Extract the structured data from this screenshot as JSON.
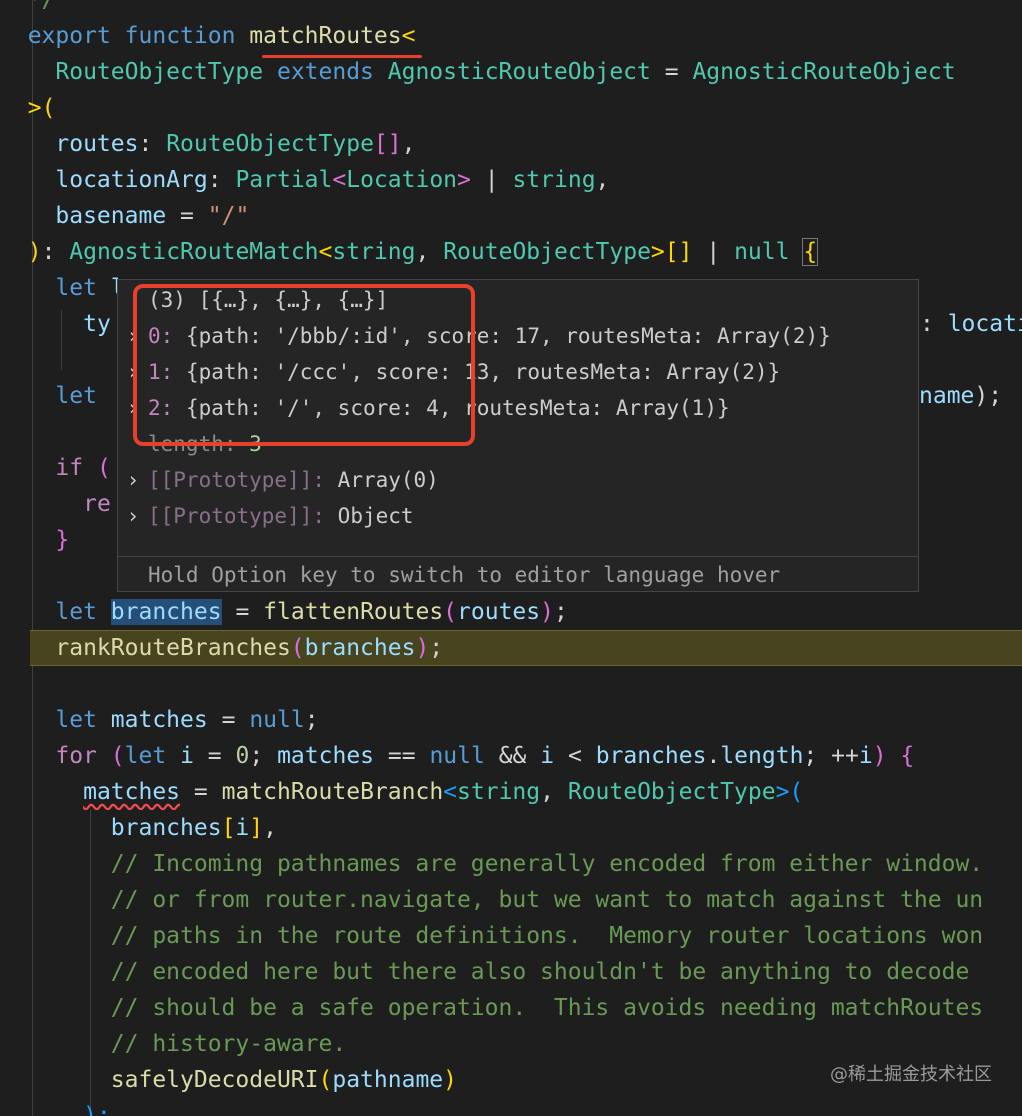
{
  "code": {
    "line0_comment": "*/",
    "line1": {
      "export": "export",
      "function": "function",
      "name": "matchRoutes",
      "open": "<"
    },
    "line2": {
      "tparam": "RouteObjectType",
      "extends": "extends",
      "t1": "AgnosticRouteObject",
      "eq": "=",
      "t2": "AgnosticRouteObject"
    },
    "line3": {
      "close": ">",
      "paren": "("
    },
    "line4": {
      "param": "routes",
      "colon": ":",
      "type": "RouteObjectType",
      "arr": "[]",
      "comma": ","
    },
    "line5": {
      "param": "locationArg",
      "colon": ":",
      "type": "Partial",
      "lt": "<",
      "inner": "Location",
      "gt": ">",
      "pipe": "|",
      "str": "string",
      "comma": ","
    },
    "line6": {
      "param": "basename",
      "eq": "=",
      "value": "\"/\""
    },
    "line7": {
      "paren": ")",
      "colon": ":",
      "type": "AgnosticRouteMatch",
      "lt": "<",
      "s": "string",
      "comma": ",",
      "t": "RouteObjectType",
      "gt": ">",
      "arr": "[]",
      "pipe": "|",
      "nul": "null",
      "brace": "{"
    },
    "line8": {
      "let": "let",
      "rest": "l"
    },
    "line9": {
      "partial": "ty",
      "right": "locati"
    },
    "line10": {
      "let": "let",
      "right": "name",
      "tail": ");"
    },
    "line11": {
      "if": "if",
      "paren": "("
    },
    "line12": {
      "partial": "re"
    },
    "line13": {
      "brace": "}"
    },
    "line14": {
      "let": "let",
      "var": "branches",
      "eq": "=",
      "fn": "flattenRoutes",
      "po": "(",
      "arg": "routes",
      "pc": ")",
      "semi": ";"
    },
    "line15": {
      "fn": "rankRouteBranches",
      "po": "(",
      "arg": "branches",
      "pc": ")",
      "semi": ";"
    },
    "line17": {
      "let": "let",
      "var": "matches",
      "eq": "=",
      "nul": "null",
      "semi": ";"
    },
    "line18": {
      "for": "for",
      "po": "(",
      "let": "let",
      "i": "i",
      "eq": "=",
      "zero": "0",
      "semi1": ";",
      "m": "matches",
      "eqeq": "==",
      "nul": "null",
      "and": "&&",
      "i2": "i",
      "lt": "<",
      "b": "branches",
      "dot": ".",
      "len": "length",
      "semi2": ";",
      "inc": "++",
      "i3": "i",
      "pc": ")",
      "brace": "{"
    },
    "line19": {
      "var": "matches",
      "eq": "=",
      "fn": "matchRouteBranch",
      "lt": "<",
      "s": "string",
      "comma": ",",
      "t": "RouteObjectType",
      "gt": ">",
      "po": "("
    },
    "line20": {
      "var": "branches",
      "bo": "[",
      "i": "i",
      "bc": "]",
      "comma": ","
    },
    "line21": "// Incoming pathnames are generally encoded from either window.",
    "line22": "// or from router.navigate, but we want to match against the un",
    "line23": "// paths in the route definitions.  Memory router locations won",
    "line24": "// encoded here but there also shouldn't be anything to decode",
    "line25": "// should be a safe operation.  This avoids needing matchRoutes",
    "line26": "// history-aware.",
    "line27": {
      "fn": "safelyDecodeURI",
      "po": "(",
      "arg": "pathname",
      "pc": ")"
    },
    "line28": {
      "close": ");"
    }
  },
  "hover": {
    "header": "(3) [{…}, {…}, {…}]",
    "items": [
      {
        "key": "0",
        "text": "{path: '/bbb/:id', score: 17, routesMeta: Array(2)}"
      },
      {
        "key": "1",
        "text": "{path: '/ccc', score: 13, routesMeta: Array(2)}"
      },
      {
        "key": "2",
        "text": "{path: '/', score: 4, routesMeta: Array(1)}"
      }
    ],
    "length_label": "length",
    "length_value": "3",
    "proto1_label": "[[Prototype]]",
    "proto1_value": "Array(0)",
    "proto2_label": "[[Prototype]]",
    "proto2_value": "Object",
    "footer": "Hold Option key to switch to editor language hover",
    "chevron_icon": "chevron-right-icon"
  },
  "watermark": "@稀土掘金技术社区",
  "colors": {
    "background": "#1e1e1e",
    "annotation": "#e8402a",
    "current_line": "#47441f"
  }
}
